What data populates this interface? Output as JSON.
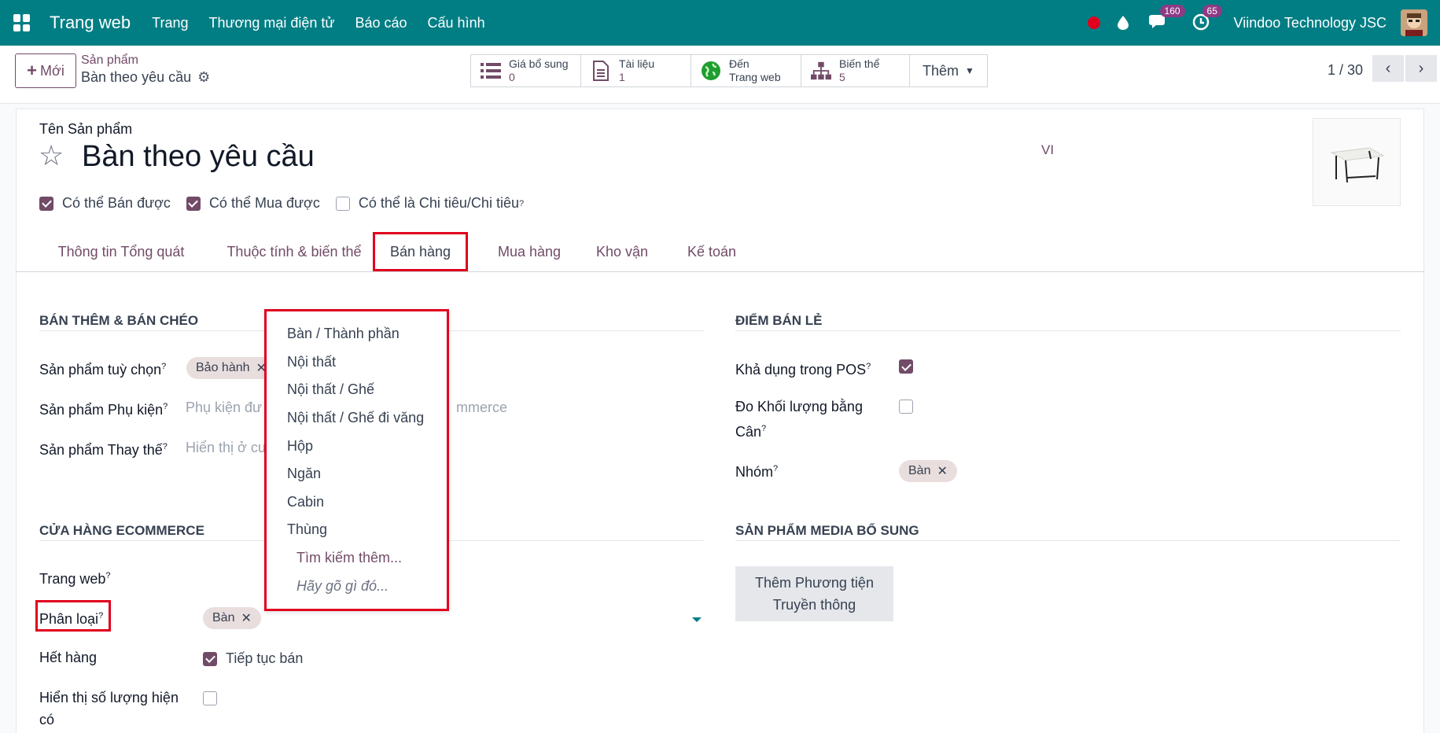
{
  "navbar": {
    "app_name": "Trang web",
    "menu": [
      "Trang",
      "Thương mại điện tử",
      "Báo cáo",
      "Cấu hình"
    ],
    "messages_count": "160",
    "activities_count": "65",
    "company": "Viindoo Technology JSC",
    "accent": "#017e84"
  },
  "control": {
    "new_label": "Mới",
    "breadcrumb_parent": "Sản phẩm",
    "breadcrumb_current": "Bàn theo yêu cầu",
    "smart_buttons": [
      {
        "label": "Giá bổ sung",
        "value": "0",
        "icon": "list-icon"
      },
      {
        "label": "Tài liệu",
        "value": "1",
        "icon": "document-icon"
      },
      {
        "label": "Đến",
        "value": "Trang web",
        "icon": "globe-icon"
      },
      {
        "label": "Biến thể",
        "value": "5",
        "icon": "sitemap-icon"
      }
    ],
    "more_label": "Thêm",
    "pager": "1 / 30"
  },
  "product": {
    "name_label": "Tên Sản phẩm",
    "name": "Bàn theo yêu cầu",
    "lang": "VI",
    "checks": [
      {
        "label": "Có thể Bán được",
        "checked": true,
        "help": ""
      },
      {
        "label": "Có thể Mua được",
        "checked": true,
        "help": ""
      },
      {
        "label": "Có thể là Chi tiêu/Chi tiêu",
        "checked": false,
        "help": "?"
      }
    ]
  },
  "tabs": [
    "Thông tin Tổng quát",
    "Thuộc tính & biến thể",
    "Bán hàng",
    "Mua hàng",
    "Kho vận",
    "Kế toán"
  ],
  "active_tab": "Bán hàng",
  "upsell": {
    "title": "BÁN THÊM & BÁN CHÉO",
    "optional_label": "Sản phẩm tuỳ chọn",
    "optional_tag": "Bảo hành",
    "accessory_label": "Sản phẩm Phụ kiện",
    "accessory_placeholder_left": "Phụ kiện đư",
    "accessory_placeholder_right": "mmerce",
    "alternative_label": "Sản phẩm Thay thế",
    "alternative_placeholder": "Hiển thị ở cu"
  },
  "ecommerce": {
    "title": "CỬA HÀNG ECOMMERCE",
    "website_label": "Trang web",
    "category_label": "Phân loại",
    "category_tag": "Bàn",
    "out_of_stock_label": "Hết hàng",
    "continue_selling": "Tiếp tục bán",
    "show_qty_label": "Hiển thị số lượng hiện có"
  },
  "pos": {
    "title": "ĐIỂM BÁN LẺ",
    "available_label": "Khả dụng trong POS",
    "weigh_label": "Đo Khối lượng bằng Cân",
    "group_label": "Nhóm",
    "group_tag": "Bàn"
  },
  "media": {
    "title": "SẢN PHẨM MEDIA BỔ SUNG",
    "add_button": "Thêm Phương tiện Truyền thông"
  },
  "dropdown": {
    "items": [
      "Bàn / Thành phần",
      "Nội thất",
      "Nội thất / Ghế",
      "Nội thất / Ghế đi văng",
      "Hộp",
      "Ngăn",
      "Cabin",
      "Thùng"
    ],
    "search_more": "Tìm kiếm thêm...",
    "hint": "Hãy gõ gì đó..."
  },
  "help_mark": "?"
}
